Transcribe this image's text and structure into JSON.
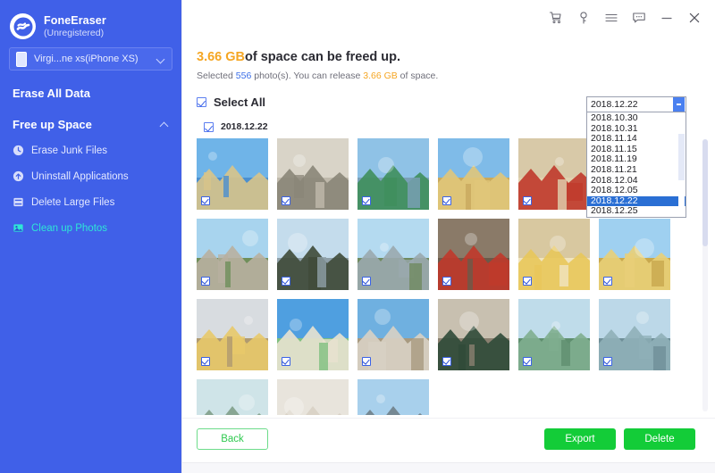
{
  "sidebar": {
    "brand": {
      "name": "FoneEraser",
      "status": "(Unregistered)",
      "logo_icon": "fone-eraser-logo-icon"
    },
    "device": {
      "value": "Virgi...ne xs(iPhone XS)",
      "icon": "phone-icon",
      "chevron": "chevron-down-icon"
    },
    "erase_all_label": "Erase All Data",
    "free_up": {
      "label": "Free up Space",
      "chevron": "chevron-up-icon"
    },
    "items": [
      {
        "label": "Erase Junk Files",
        "icon": "clock-icon",
        "active": false
      },
      {
        "label": "Uninstall Applications",
        "icon": "uninstall-icon",
        "active": false
      },
      {
        "label": "Delete Large Files",
        "icon": "files-icon",
        "active": false
      },
      {
        "label": "Clean up Photos",
        "icon": "photos-icon",
        "active": true
      }
    ],
    "bg_color": "#4060e8",
    "active_color": "#2ee6d6"
  },
  "titlebar": {
    "buttons": [
      {
        "name": "cart-icon",
        "label": "Cart"
      },
      {
        "name": "key-icon",
        "label": "Register"
      },
      {
        "name": "menu-icon",
        "label": "Menu"
      },
      {
        "name": "feedback-icon",
        "label": "Feedback"
      },
      {
        "name": "minimize-icon",
        "label": "Minimize"
      },
      {
        "name": "close-icon",
        "label": "Close"
      }
    ]
  },
  "summary": {
    "size": "3.66 GB",
    "title_rest": "of space can be freed up.",
    "sub_prefix": "Selected ",
    "count": "556",
    "sub_mid": " photo(s). You can release ",
    "sub_size": "3.66 GB",
    "sub_suffix": " of space.",
    "accent_orange": "#f5a623",
    "accent_blue": "#3a6ee8"
  },
  "select_all": {
    "label": "Select All",
    "checked": true
  },
  "date_group": {
    "label": "2018.12.22",
    "checked": true
  },
  "dropdown": {
    "value": "2018.12.22",
    "arrow_icon": "dropdown-arrow-icon",
    "options": [
      "2018.10.30",
      "2018.10.31",
      "2018.11.14",
      "2018.11.15",
      "2018.11.19",
      "2018.11.21",
      "2018.12.04",
      "2018.12.05",
      "2018.12.22",
      "2018.12.25"
    ],
    "selected_index": 8,
    "selected_bg": "#2a6fd4"
  },
  "photos": [
    {
      "name": "grand-lisboa-building",
      "checked": true,
      "c1": "#6fb4e8",
      "c2": "#d8c48a",
      "c3": "#4a8fd0"
    },
    {
      "name": "fish-mosaic-pavement",
      "checked": true,
      "c1": "#d9d4c8",
      "c2": "#8a8678",
      "c3": "#bfb9ab"
    },
    {
      "name": "green-corner-building",
      "checked": true,
      "c1": "#8fc2e6",
      "c2": "#3f8f5c",
      "c3": "#7aa0b8"
    },
    {
      "name": "yellow-church-facade",
      "checked": true,
      "c1": "#7fbbe8",
      "c2": "#e0c77a",
      "c3": "#c8a95e"
    },
    {
      "name": "red-shrine-altar",
      "checked": true,
      "c1": "#d8c9a8",
      "c2": "#c0392b",
      "c3": "#e0d2b0"
    },
    {
      "name": "pastel-building-street",
      "checked": true,
      "c1": "#9fd0f0",
      "c2": "#e6d9a0",
      "c3": "#bfae78"
    },
    {
      "name": "city-skyline-hill",
      "checked": true,
      "c1": "#a8d4ee",
      "c2": "#b8b0a0",
      "c3": "#6f8f5a"
    },
    {
      "name": "tower-and-trees",
      "checked": true,
      "c1": "#c4dcec",
      "c2": "#3f4a38",
      "c3": "#8fa0a8"
    },
    {
      "name": "downtown-highrises",
      "checked": true,
      "c1": "#b4daf0",
      "c2": "#9aa8ae",
      "c3": "#6f8a60"
    },
    {
      "name": "red-truck-street",
      "checked": true,
      "c1": "#8a7a68",
      "c2": "#c0392b",
      "c3": "#6a5a4a"
    },
    {
      "name": "bowl-of-dumplings",
      "checked": true,
      "c1": "#d8c8a0",
      "c2": "#e8c65a",
      "c3": "#f0e4c0"
    },
    {
      "name": "st-dominic-church",
      "checked": true,
      "c1": "#9fd0f0",
      "c2": "#e8cf78",
      "c3": "#c8a84e"
    },
    {
      "name": "colonial-square",
      "checked": true,
      "c1": "#d8dce0",
      "c2": "#e8c96a",
      "c3": "#b09a70"
    },
    {
      "name": "twin-towers-sky",
      "checked": true,
      "c1": "#4f9fe0",
      "c2": "#e8e2d0",
      "c3": "#7fbf7f"
    },
    {
      "name": "monument-column",
      "checked": true,
      "c1": "#6fb0e0",
      "c2": "#d8d2c4",
      "c3": "#a89a80"
    },
    {
      "name": "vintage-locomotive",
      "checked": true,
      "c1": "#c8c0b0",
      "c2": "#2f4a38",
      "c3": "#8a8070"
    },
    {
      "name": "sea-bridge-horizon",
      "checked": true,
      "c1": "#bfdcea",
      "c2": "#7fae8f",
      "c3": "#5f8f6f"
    },
    {
      "name": "boat-on-water",
      "checked": true,
      "c1": "#bcd8e8",
      "c2": "#8fb0b8",
      "c3": "#6f8f98"
    },
    {
      "name": "riverside-park",
      "checked": false,
      "c1": "#cfe4e8",
      "c2": "#7f9f8a",
      "c3": "#4f6f5a"
    },
    {
      "name": "shop-storefront",
      "checked": false,
      "c1": "#e8e4dc",
      "c2": "#d8d0c4",
      "c3": "#b8a890"
    },
    {
      "name": "eiffel-tower-replica",
      "checked": false,
      "c1": "#a8d0ec",
      "c2": "#6f7f8a",
      "c3": "#4f5a62"
    }
  ],
  "footer": {
    "back_label": "Back",
    "export_label": "Export",
    "delete_label": "Delete",
    "green": "#13cc38",
    "back_border": "#6ddc8a"
  }
}
